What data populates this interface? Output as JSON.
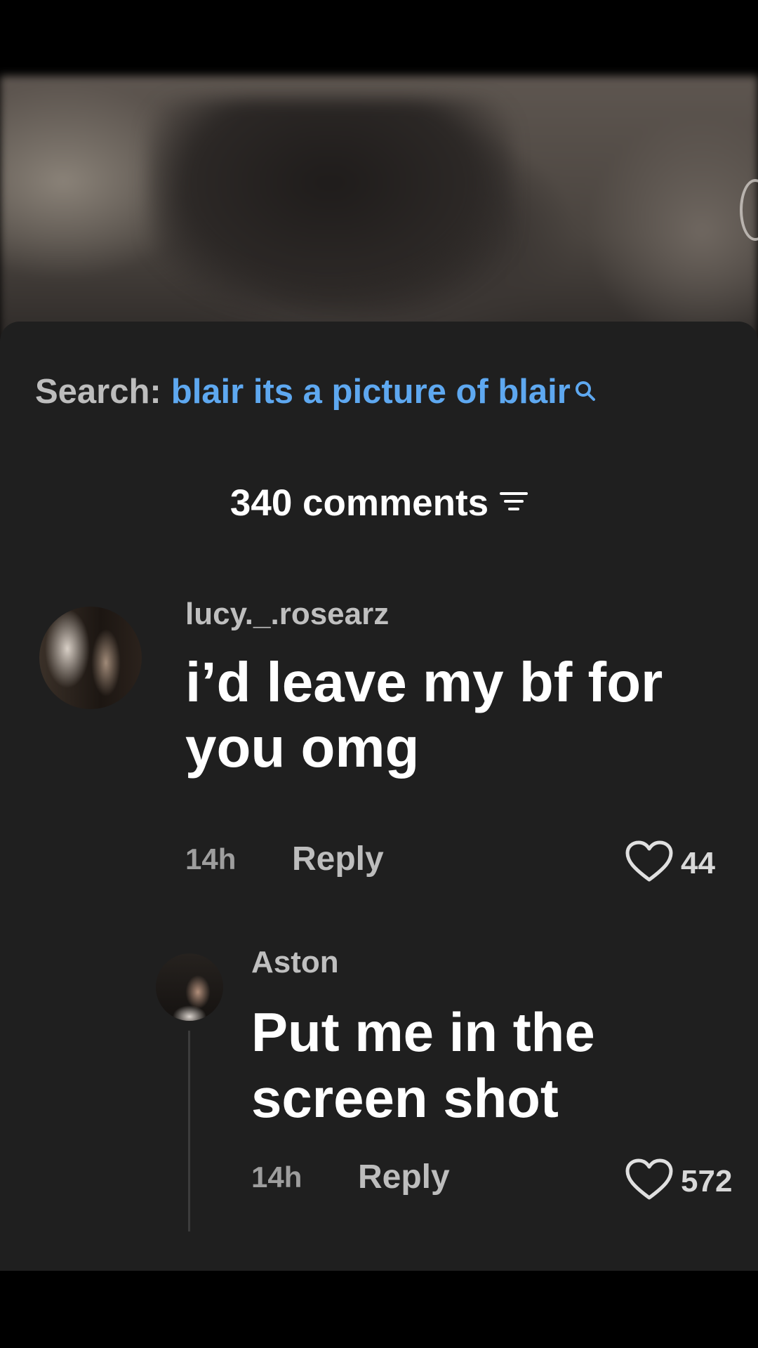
{
  "search": {
    "label": "Search:",
    "query": "blair its a picture of blair",
    "icon": "search-icon"
  },
  "comments_header": {
    "count_label": "340 comments",
    "icon": "filter-icon"
  },
  "comments": [
    {
      "username": "lucy._.rosearz",
      "text_line1": "i’d leave my bf for",
      "text_line2": "you omg",
      "time": "14h",
      "reply_label": "Reply",
      "likes": "44"
    },
    {
      "username": "Aston",
      "text_line1": "Put me in the",
      "text_line2": "screen shot",
      "time": "14h",
      "reply_label": "Reply",
      "likes": "572"
    }
  ],
  "colors": {
    "sheet_bg": "#1f1f1f",
    "query_blue": "#5ea8f0",
    "text_white": "#ffffff",
    "text_gray": "#bdbdbd"
  }
}
